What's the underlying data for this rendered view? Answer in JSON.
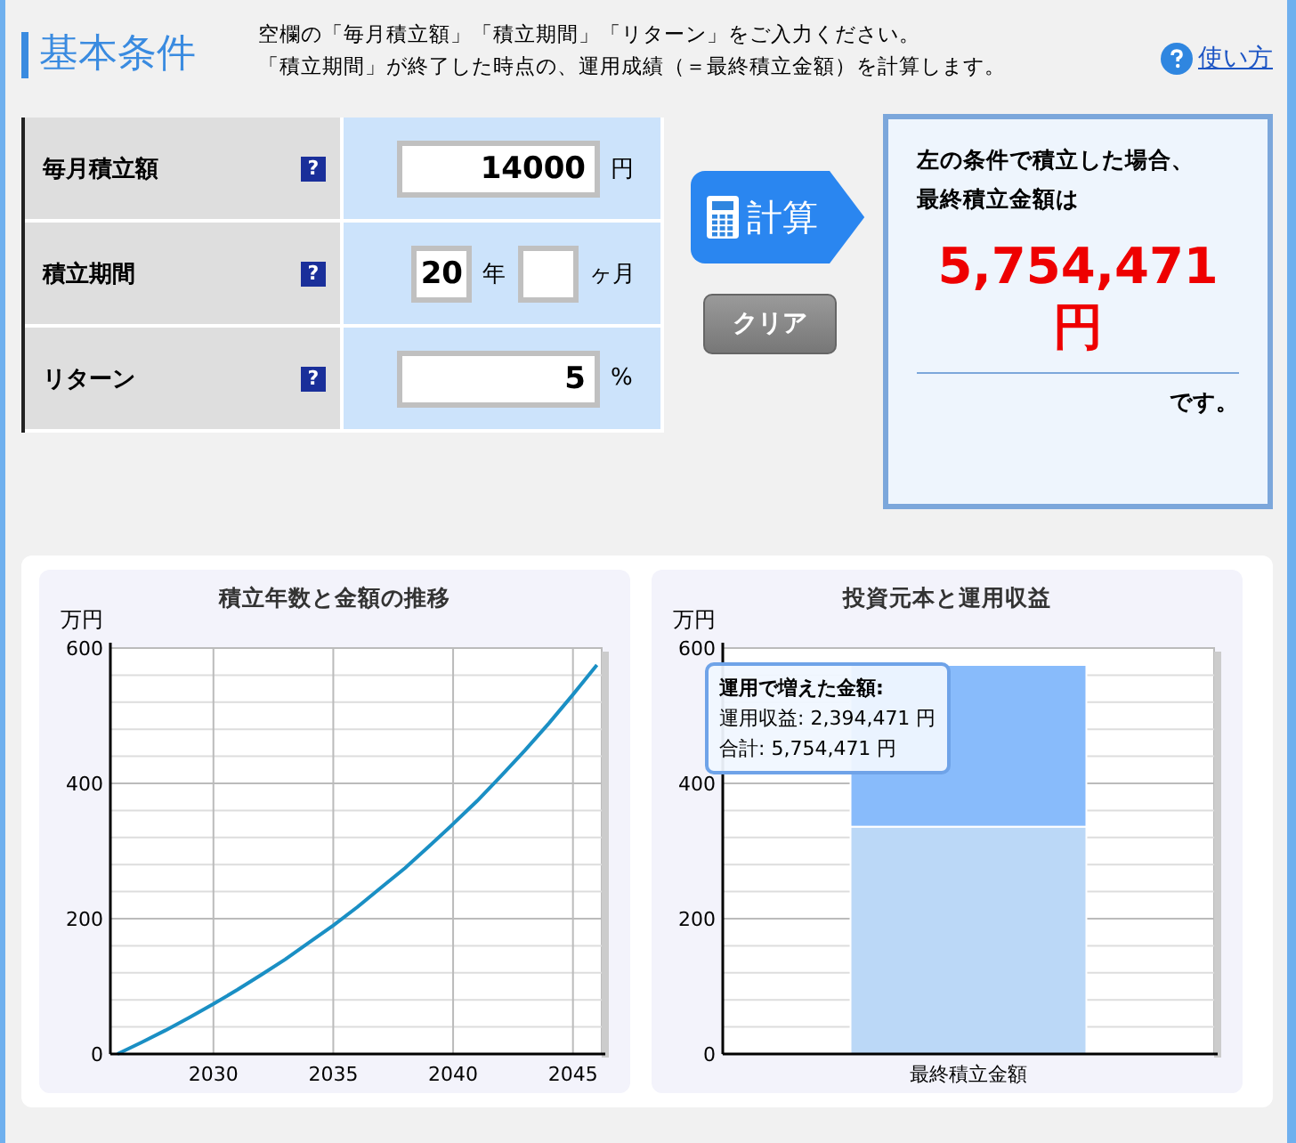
{
  "header": {
    "title": "基本条件",
    "description": [
      "空欄の「毎月積立額」「積立期間」「リターン」をご入力ください。",
      "「積立期間」が終了した時点の、運用成績（＝最終積立金額）を計算します。"
    ],
    "help_link": "使い方"
  },
  "form": {
    "rows": [
      {
        "kind": "amount",
        "label": "毎月積立額",
        "help": "?",
        "value": "14000",
        "unit": "円"
      },
      {
        "kind": "period",
        "label": "積立期間",
        "help": "?",
        "years": "20",
        "years_unit": "年",
        "months_unit": "ヶ月"
      },
      {
        "kind": "amount",
        "label": "リターン",
        "help": "?",
        "value": "5",
        "unit": "%"
      }
    ]
  },
  "buttons": {
    "calculate": "計算",
    "clear": "クリア"
  },
  "result": {
    "intro": [
      "左の条件で積立した場合、",
      "最終積立金額は"
    ],
    "amount": "5,754,471",
    "unit": "円",
    "suffix": "です。"
  },
  "charts": [
    {
      "unit": "万円",
      "chart_data": {
        "type": "line",
        "title": "積立年数と金額の推移",
        "x": [
          2026,
          2027,
          2028,
          2029,
          2030,
          2031,
          2032,
          2033,
          2034,
          2035,
          2036,
          2037,
          2038,
          2039,
          2040,
          2041,
          2042,
          2043,
          2044,
          2045,
          2046
        ],
        "series": [
          {
            "color": "#1a8fc4",
            "values": [
              0,
              17,
              35,
              54,
              74,
              95,
              117,
              140,
              165,
              190,
              217,
              246,
              275,
              307,
              340,
              374,
              411,
              449,
              489,
              531,
              575
            ]
          }
        ],
        "xlim": [
          2025.7,
          2046.2
        ],
        "ylim": [
          0,
          600
        ],
        "xticks": [
          2030,
          2035,
          2040,
          2045
        ],
        "yticks": [
          0,
          200,
          400,
          600
        ],
        "grid": true
      }
    },
    {
      "unit": "万円",
      "chart_data": {
        "type": "bar",
        "title": "投資元本と運用収益",
        "categories": [
          "最終積立金額"
        ],
        "stacked": true,
        "series": [
          {
            "color": "#bbd8f7",
            "values": [
              336
            ]
          },
          {
            "color": "#88bbfb",
            "values": [
              239
            ]
          }
        ],
        "ylim": [
          0,
          600
        ],
        "yticks": [
          0,
          200,
          400,
          600
        ],
        "grid": true
      },
      "tooltip": {
        "title": "運用で増えた金額:",
        "lines": [
          "運用収益: 2,394,471 円",
          "合計: 5,754,471 円"
        ]
      }
    }
  ]
}
